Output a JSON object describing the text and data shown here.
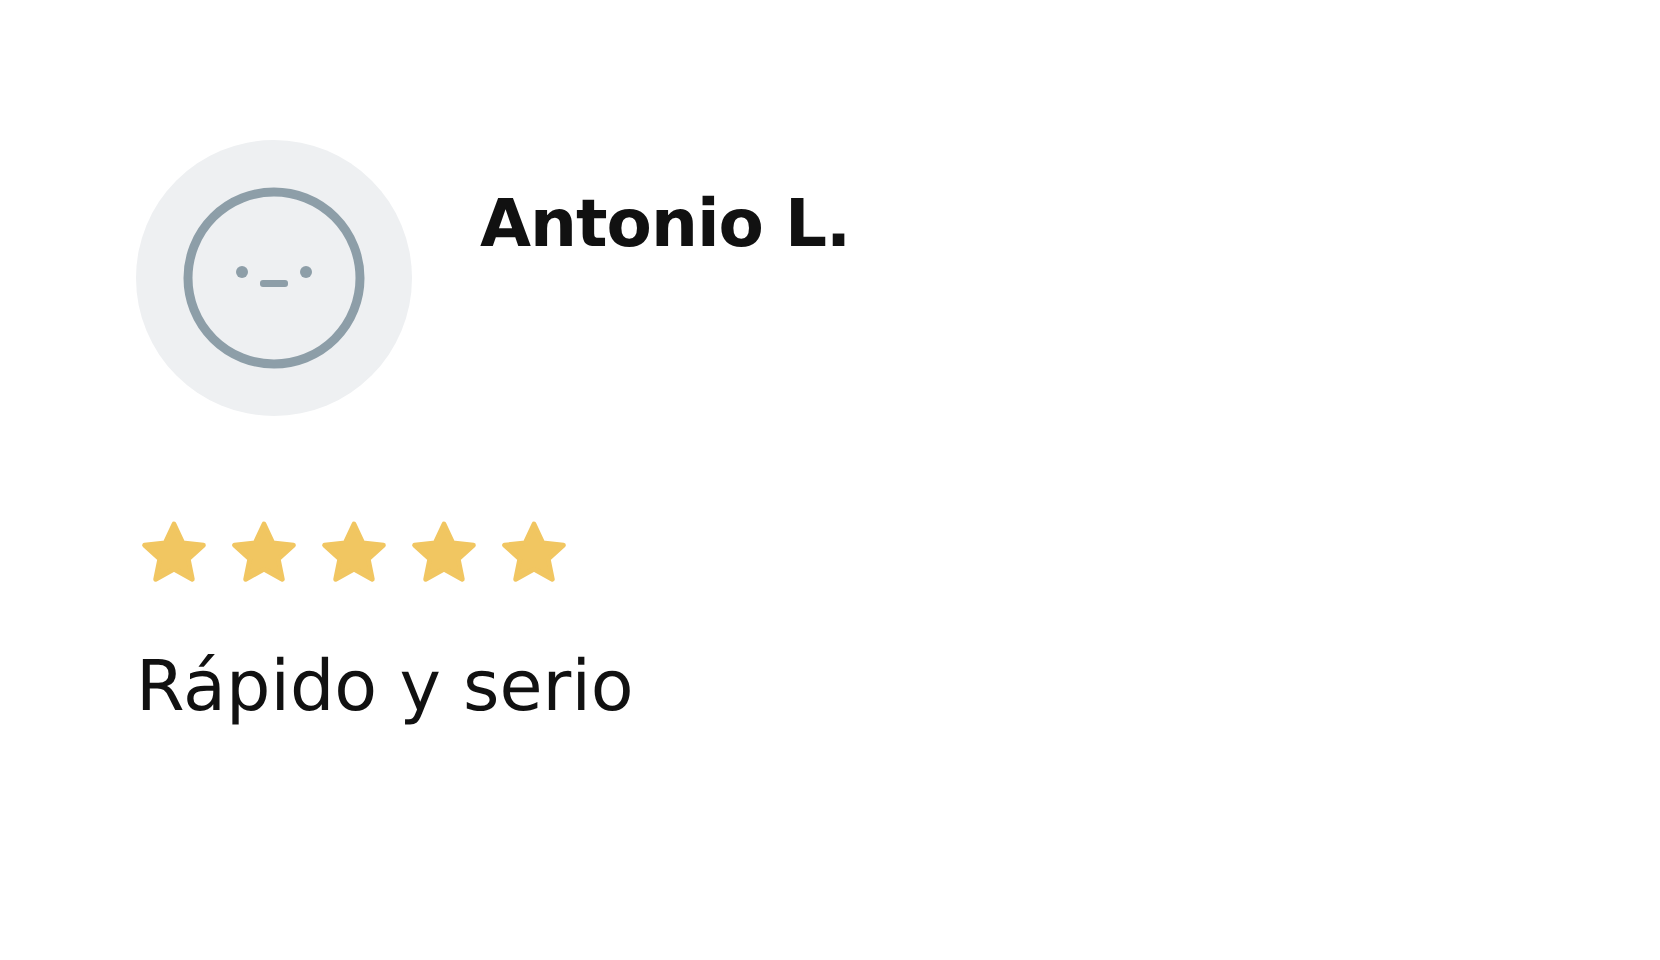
{
  "review": {
    "author": "Antonio L.",
    "stars": 5,
    "text": "Rápido y serio"
  }
}
